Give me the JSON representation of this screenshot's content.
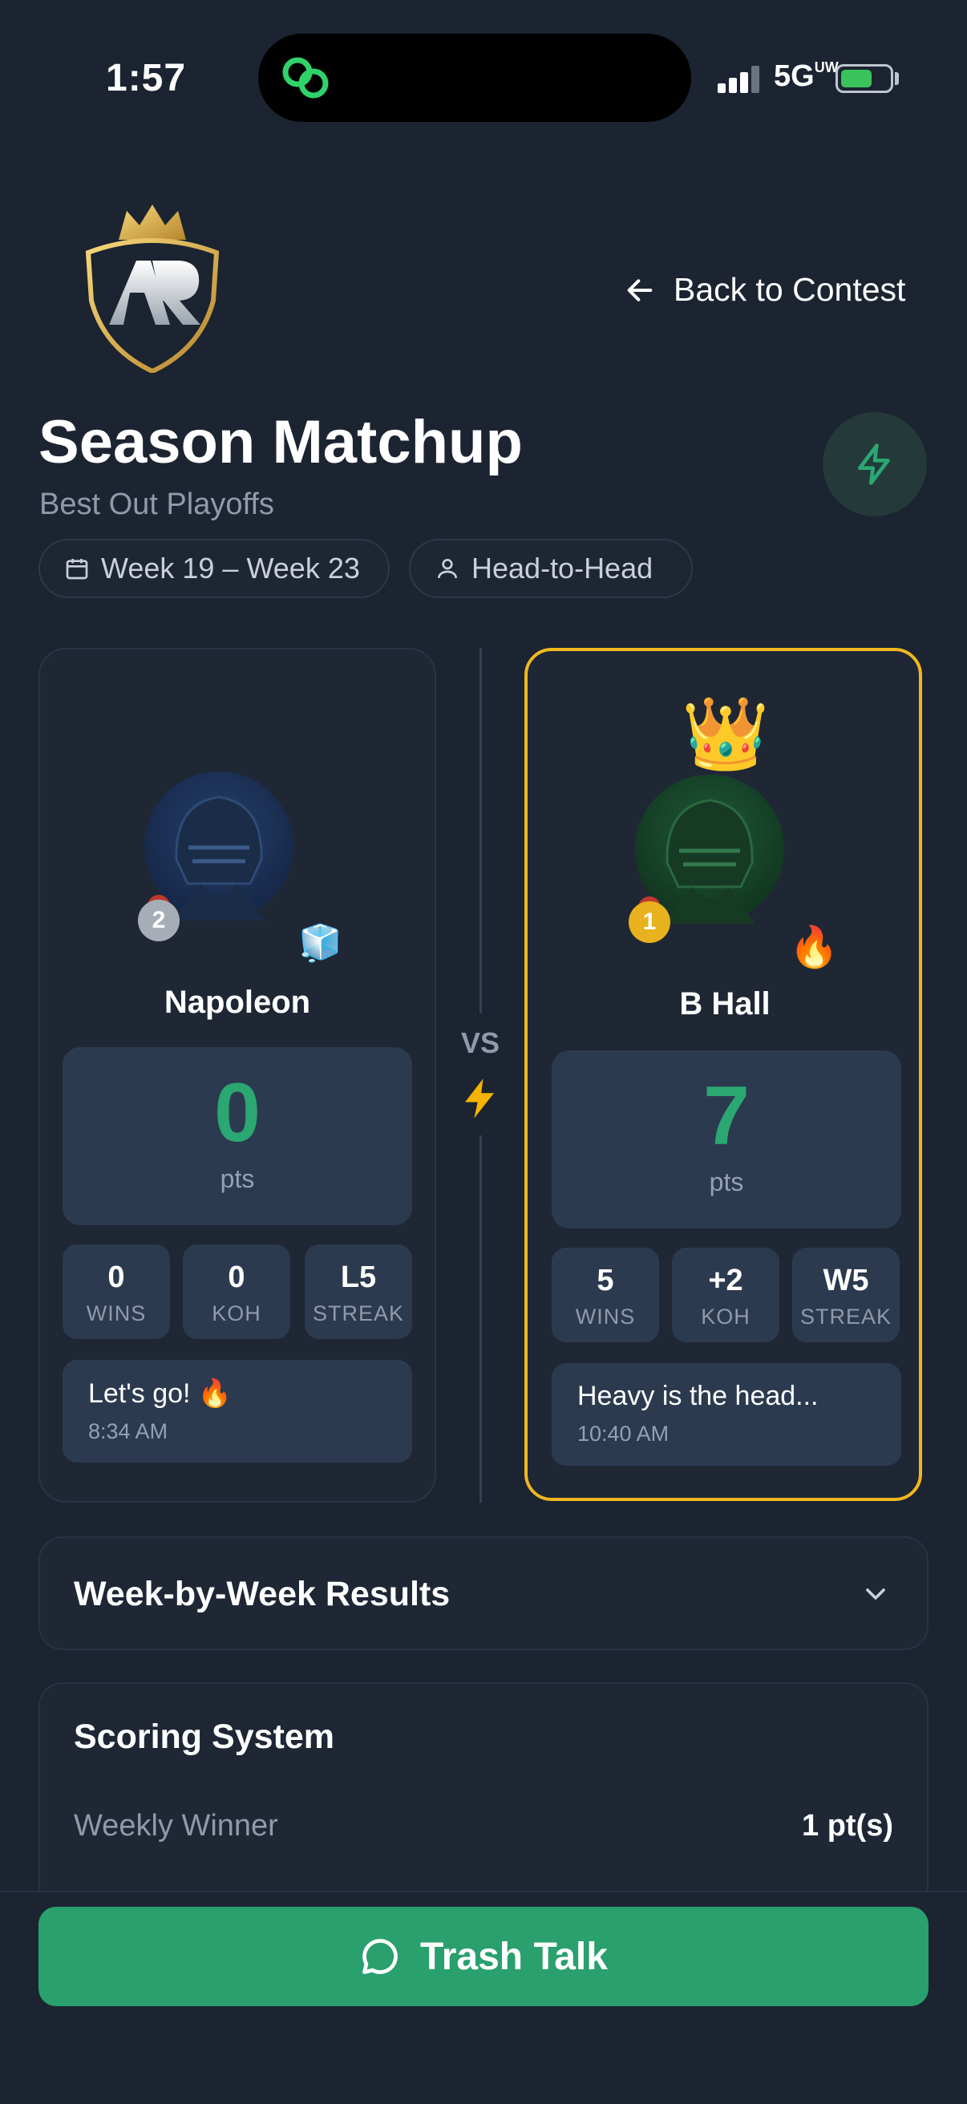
{
  "status": {
    "time": "1:57",
    "network": "5G",
    "network_suffix": "UW"
  },
  "header": {
    "back_label": "Back to Contest",
    "title": "Season Matchup",
    "subtitle": "Best Out Playoffs"
  },
  "chips": [
    {
      "label": "Week 19 – Week 23",
      "icon": "calendar-icon"
    },
    {
      "label": "Head-to-Head",
      "icon": "person-icon"
    }
  ],
  "versus": {
    "label": "VS"
  },
  "players": [
    {
      "name": "Napoleon",
      "points": "0",
      "points_label": "pts",
      "rank_medal": "2",
      "status_emoji": "🧊",
      "stats": [
        {
          "value": "0",
          "label": "WINS"
        },
        {
          "value": "0",
          "label": "KOH"
        },
        {
          "value": "L5",
          "label": "STREAK"
        }
      ],
      "message": {
        "text": "Let's go! 🔥",
        "time": "8:34 AM"
      }
    },
    {
      "name": "B Hall",
      "points": "7",
      "points_label": "pts",
      "rank_medal": "1",
      "status_emoji": "🔥",
      "crown": "👑",
      "stats": [
        {
          "value": "5",
          "label": "WINS"
        },
        {
          "value": "+2",
          "label": "KOH"
        },
        {
          "value": "W5",
          "label": "STREAK"
        }
      ],
      "message": {
        "text": "Heavy is the head...",
        "time": "10:40 AM"
      }
    }
  ],
  "week_results": {
    "title": "Week-by-Week Results"
  },
  "scoring": {
    "title": "Scoring System",
    "rows": [
      {
        "label": "Weekly Winner",
        "value": "1 pt(s)"
      }
    ]
  },
  "cta": {
    "label": "Trash Talk"
  },
  "colors": {
    "accent_green": "#2ba772",
    "winner_border": "#f0b81f",
    "background": "#1c2431"
  }
}
